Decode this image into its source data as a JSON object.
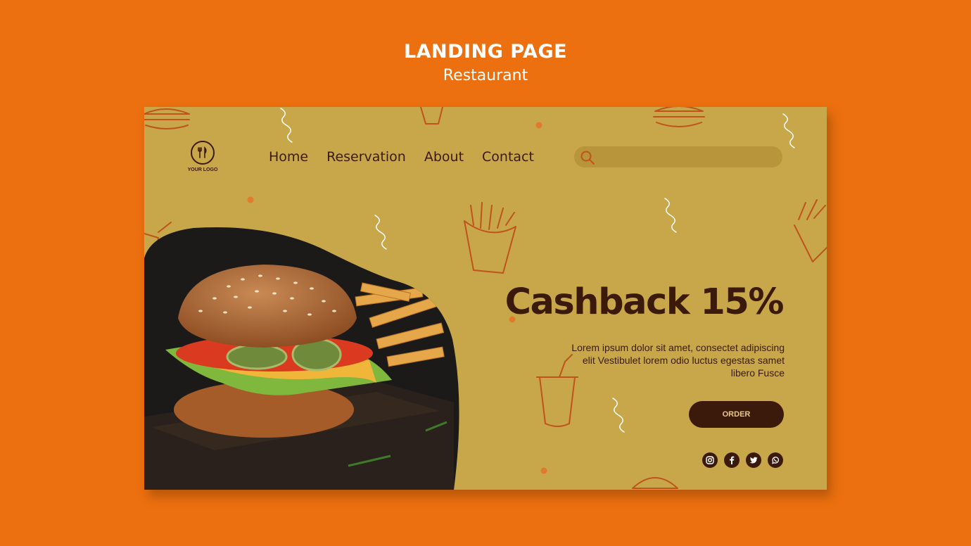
{
  "header": {
    "title": "LANDING PAGE",
    "subtitle": "Restaurant"
  },
  "logo": {
    "text": "YOUR LOGO"
  },
  "nav": {
    "items": [
      "Home",
      "Reservation",
      "About",
      "Contact"
    ]
  },
  "search": {
    "placeholder": "",
    "value": ""
  },
  "hero": {
    "title": "Cashback 15%",
    "text": "Lorem ipsum dolor sit amet, consectet adipiscing elit Vestibulet lorem odio luctus egestas samet libero Fusce",
    "order_label": "ORDER"
  },
  "socials": [
    "instagram-icon",
    "facebook-icon",
    "twitter-icon",
    "whatsapp-icon"
  ],
  "colors": {
    "background": "#ec700f",
    "card": "#c8a74a",
    "dark_brown": "#3b1a0c",
    "accent_line": "#c0521c"
  }
}
